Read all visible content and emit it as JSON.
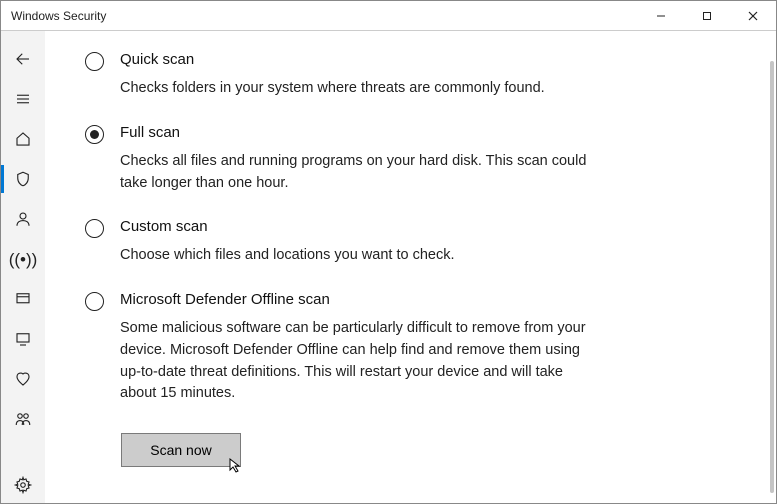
{
  "window": {
    "title": "Windows Security"
  },
  "sidebar": {
    "items": [
      {
        "name": "back-icon"
      },
      {
        "name": "menu-icon"
      },
      {
        "name": "home-icon"
      },
      {
        "name": "shield-icon",
        "active": true
      },
      {
        "name": "account-icon"
      },
      {
        "name": "firewall-icon"
      },
      {
        "name": "app-browser-icon"
      },
      {
        "name": "device-security-icon"
      },
      {
        "name": "device-health-icon"
      },
      {
        "name": "family-icon"
      }
    ],
    "settings": {
      "name": "settings-icon"
    }
  },
  "options": [
    {
      "id": "quick",
      "title": "Quick scan",
      "desc": "Checks folders in your system where threats are commonly found.",
      "selected": false
    },
    {
      "id": "full",
      "title": "Full scan",
      "desc": "Checks all files and running programs on your hard disk. This scan could take longer than one hour.",
      "selected": true
    },
    {
      "id": "custom",
      "title": "Custom scan",
      "desc": "Choose which files and locations you want to check.",
      "selected": false
    },
    {
      "id": "offline",
      "title": "Microsoft Defender Offline scan",
      "desc": "Some malicious software can be particularly difficult to remove from your device. Microsoft Defender Offline can help find and remove them using up-to-date threat definitions. This will restart your device and will take about 15 minutes.",
      "selected": false
    }
  ],
  "action": {
    "scan_label": "Scan now"
  }
}
